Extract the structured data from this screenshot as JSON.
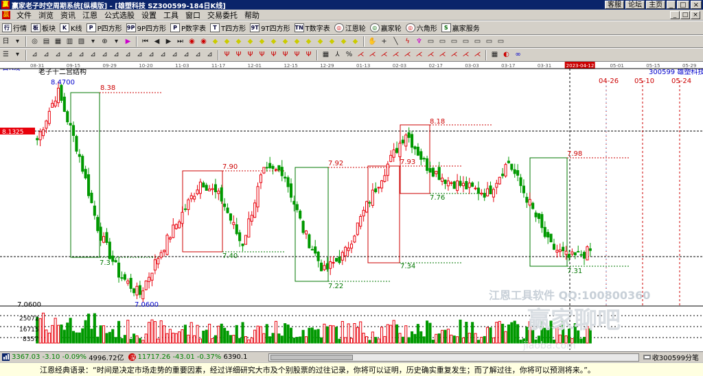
{
  "window": {
    "title": "赢家老子时空周期系统[纵横版]  -  [雄塑科技   SZ300599-184日K线]",
    "links": [
      "客服",
      "论坛",
      "主页"
    ],
    "controls": [
      "_",
      "□",
      "×"
    ]
  },
  "menu": [
    "文件",
    "浏览",
    "资讯",
    "江恩",
    "公式选股",
    "设置",
    "工具",
    "窗口",
    "交易委托",
    "帮助"
  ],
  "toolbar1": [
    {
      "icon": "行",
      "label": "行情"
    },
    {
      "icon": "板",
      "label": "板块"
    },
    {
      "icon": "K",
      "label": "K线"
    },
    {
      "icon": "P",
      "label": "P四方形"
    },
    {
      "icon": "9P",
      "label": "9P四方形"
    },
    {
      "icon": "P",
      "label": "P数字表"
    },
    {
      "icon": "T",
      "label": "T四方形"
    },
    {
      "icon": "9T",
      "label": "9T四方形"
    },
    {
      "icon": "TN",
      "label": "T数字表"
    },
    {
      "icon": "◎",
      "label": "江恩轮"
    },
    {
      "icon": "◎",
      "label": "赢家轮"
    },
    {
      "icon": "◎",
      "label": "六角形"
    },
    {
      "icon": "S",
      "label": "赢家服务"
    }
  ],
  "chart": {
    "period_label": "日K线",
    "structure_label": "老子十二宫结构",
    "stock_label": "300599  雄塑科技",
    "current_price_label": "8.1325",
    "date_ticks": [
      "08-31",
      "09-15",
      "09-29",
      "10-20",
      "11-03",
      "11-17",
      "12-01",
      "12-15",
      "12-29",
      "01-13",
      "02-03",
      "02-17",
      "03-03",
      "03-17",
      "03-31",
      "2023-04-12",
      "05-01",
      "05-15",
      "05-29"
    ],
    "future_dates": [
      "04-26",
      "05-10",
      "05-24"
    ],
    "annotations": {
      "peak": "8.4700",
      "low": "7.0600",
      "y_label_low": "7.0600"
    },
    "boxes": [
      {
        "top": "8.38",
        "bottom": "7.3"
      },
      {
        "top": "7.90",
        "bottom": "7.40"
      },
      {
        "top": "7.92",
        "bottom": "7.22"
      },
      {
        "top": "7.93",
        "bottom": "7.34"
      },
      {
        "top": "8.18",
        "bottom": "7.76"
      },
      {
        "top": "7.98",
        "bottom": "7.31"
      }
    ],
    "volume_ticks": [
      "25072",
      "16715",
      "8357"
    ],
    "watermark1": "江恩工具软件  QQ:100800360",
    "watermark2": "赢家聊吧",
    "watermark3": "jiaoba.com",
    "colors": {
      "up": "#e8000b",
      "down": "#009900",
      "grid": "#000000",
      "box_red": "#cc0000",
      "box_green": "#007700"
    }
  },
  "chart_data": {
    "type": "candlestick",
    "title": "",
    "ylim": [
      7.0,
      8.55
    ],
    "x": [
      "08-31",
      "09-15",
      "09-29",
      "10-20",
      "11-03",
      "11-17",
      "12-01",
      "12-15",
      "12-29",
      "01-13",
      "02-03",
      "02-17",
      "03-03",
      "03-17",
      "03-31",
      "2023-04-12"
    ],
    "close": [
      8.13,
      8.47,
      8.05,
      7.5,
      7.2,
      7.06,
      7.35,
      7.6,
      7.85,
      7.72,
      7.4,
      7.9,
      7.92,
      7.5,
      7.22,
      7.34,
      7.65,
      7.93,
      8.18,
      7.95,
      7.85,
      7.8,
      7.76,
      7.98,
      7.7,
      7.4,
      7.31,
      7.36
    ],
    "volume_ticks": [
      25072,
      16715,
      8357
    ]
  },
  "status": {
    "idx1_value": "3367.03",
    "idx1_change": "-3.10",
    "idx1_pct": "-0.09%",
    "idx1_amount": "4996.72亿",
    "idx2_value": "11717.26",
    "idx2_change": "-43.01",
    "idx2_pct": "-0.37%",
    "idx2_amount": "6390.1",
    "record": "收300599分笔"
  },
  "quote": "江恩经典语录：“时间是决定市场走势的重要因素，经过详细研究大市及个别股票的过往记录，你将可以证明，历史确实重复发生；而了解过往，你将可以预测将来。”。"
}
